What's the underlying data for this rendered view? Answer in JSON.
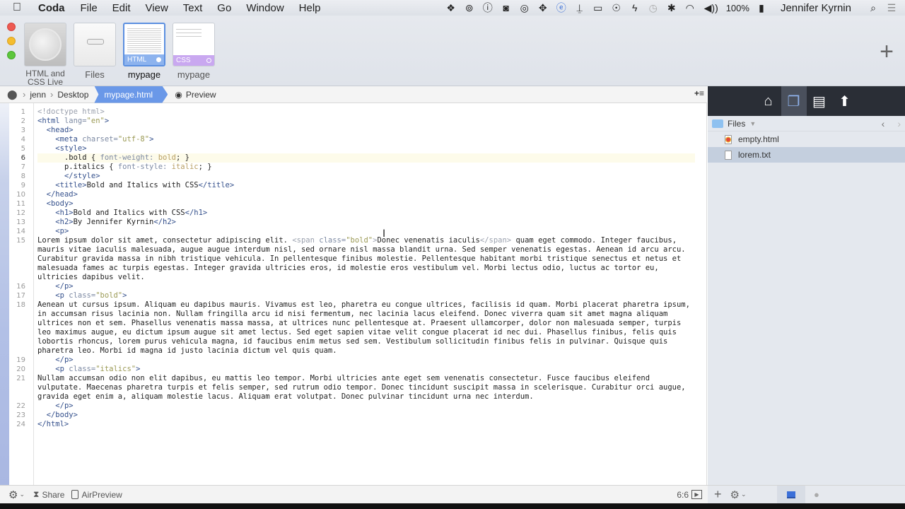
{
  "menubar": {
    "apple": "",
    "app_name": "Coda",
    "menus": [
      "File",
      "Edit",
      "View",
      "Text",
      "Go",
      "Window",
      "Help"
    ],
    "status_icons": [
      "dropbox-icon",
      "openvpn-icon",
      "1password-icon",
      "camera-icon",
      "creative-cloud-icon",
      "paw-icon",
      "te-icon",
      "brush-icon",
      "airplay-icon",
      "accessibility-icon",
      "bolt-icon",
      "time-machine-icon",
      "bluetooth-icon",
      "wifi-icon",
      "volume-icon"
    ],
    "status_glyphs": [
      "❖",
      "⊚",
      "ⓘ",
      "◙",
      "◎",
      "✥",
      "ⓔ",
      "⍊",
      "▭",
      "☉",
      "ϟ",
      "◷",
      "✱",
      "◠",
      "◀))"
    ],
    "battery": "100%",
    "battery_glyph": "▮",
    "user": "Jennifer Kyrnin",
    "search_glyph": "⌕",
    "list_glyph": "☰"
  },
  "toolbar": {
    "sites": [
      {
        "label_line1": "HTML and",
        "label_line2": "CSS Live"
      },
      {
        "label": "Files"
      },
      {
        "label": "mypage",
        "badge": "HTML"
      },
      {
        "label": "mypage",
        "badge": "CSS"
      }
    ],
    "add_glyph": "+"
  },
  "pathbar": {
    "crumbs": [
      "jenn",
      "Desktop"
    ],
    "active_file": "mypage.html",
    "active_chevron": "⌄",
    "preview": "Preview",
    "add_menu": "+≡"
  },
  "editor": {
    "current_line": 6,
    "line_numbers": [
      1,
      2,
      3,
      4,
      5,
      6,
      7,
      8,
      9,
      10,
      11,
      12,
      13,
      14,
      15,
      16,
      17,
      18,
      19,
      20,
      21,
      22,
      23,
      24
    ],
    "lines": {
      "l1": "<!doctype html>",
      "l2_tag_open": "<html ",
      "l2_attr": "lang=",
      "l2_val": "\"en\"",
      "l2_close": ">",
      "l3": "<head>",
      "l4_tag": "<meta ",
      "l4_attr": "charset=",
      "l4_val": "\"utf-8\"",
      "l4_close": ">",
      "l5": "<style>",
      "l6_sel": ".bold { ",
      "l6_prop": "font-weight: ",
      "l6_val": "bold",
      "l6_end": "; }",
      "l7_sel": "p.italics { ",
      "l7_prop": "font-style: ",
      "l7_val": "italic",
      "l7_end": "; }",
      "l8": "</style>",
      "l9_open": "<title>",
      "l9_text": "Bold and Italics with CSS",
      "l9_close": "</title>",
      "l10": "</head>",
      "l11": "<body>",
      "l12_open": "<h1>",
      "l12_text": "Bold and Italics with CSS",
      "l12_close": "</h1>",
      "l13_open": "<h2>",
      "l13_text": "By Jennifer Kyrnin",
      "l13_close": "</h2>",
      "l14": "<p>",
      "l15_a": "Lorem ipsum dolor sit amet, consectetur adipiscing elit. ",
      "l15_span_open": "<span ",
      "l15_span_attr": "class=",
      "l15_span_val": "\"bold\"",
      "l15_span_gt": ">",
      "l15_b": "Donec venenatis iaculis",
      "l15_span_close": "</span>",
      "l15_c": " quam eget commodo. Integer faucibus, mauris vitae iaculis malesuada, augue augue interdum nisl, sed ornare nisl massa blandit urna. Sed semper venenatis egestas. Aenean id arcu arcu. Curabitur gravida massa in nibh tristique vehicula. In pellentesque finibus molestie. Pellentesque habitant morbi tristique senectus et netus et malesuada fames ac turpis egestas. Integer gravida ultricies eros, id molestie eros vestibulum vel. Morbi lectus odio, luctus ac tortor eu, ultricies dapibus velit.",
      "l16": "</p>",
      "l17_tag": "<p ",
      "l17_attr": "class=",
      "l17_val": "\"bold\"",
      "l17_close": ">",
      "l18": "Aenean ut cursus ipsum. Aliquam eu dapibus mauris. Vivamus est leo, pharetra eu congue ultrices, facilisis id quam. Morbi placerat pharetra ipsum, in accumsan risus lacinia non. Nullam fringilla arcu id nisi fermentum, nec lacinia lacus eleifend. Donec viverra quam sit amet magna aliquam ultrices non et sem. Phasellus venenatis massa massa, at ultrices nunc pellentesque at. Praesent ullamcorper, dolor non malesuada semper, turpis leo maximus augue, eu dictum ipsum augue sit amet lectus. Sed eget sapien vitae velit congue placerat id nec dui. Phasellus finibus, felis quis lobortis rhoncus, lorem purus vehicula magna, id faucibus enim metus sed sem. Vestibulum sollicitudin finibus felis in pulvinar. Quisque quis pharetra leo. Morbi id magna id justo lacinia dictum vel quis quam.",
      "l19": "</p>",
      "l20_tag": "<p ",
      "l20_attr": "class=",
      "l20_val": "\"italics\"",
      "l20_close": ">",
      "l21": "Nullam accumsan odio non elit dapibus, eu mattis leo tempor. Morbi ultricies ante eget sem venenatis consectetur. Fusce faucibus eleifend vulputate. Maecenas pharetra turpis et felis semper, sed rutrum odio tempor. Donec tincidunt suscipit massa in scelerisque. Curabitur orci augue, gravida eget enim a, aliquam molestie lacus. Aliquam erat volutpat. Donec pulvinar tincidunt urna nec interdum.",
      "l22": "</p>",
      "l23": "</body>",
      "l24": "</html>"
    }
  },
  "sidebar": {
    "tabs": [
      "home-icon",
      "files-icon",
      "snippets-icon",
      "publish-icon"
    ],
    "tab_glyphs": [
      "⌂",
      "❐",
      "▤",
      "⬆"
    ],
    "folder": "Files",
    "nav_back": "‹",
    "nav_forward": "›",
    "files": [
      {
        "name": "empty.html",
        "type": "html",
        "selected": false
      },
      {
        "name": "lorem.txt",
        "type": "txt",
        "selected": true
      }
    ]
  },
  "statusbar": {
    "gear_glyph": "⚙",
    "share": "Share",
    "airpreview": "AirPreview",
    "cursor_position": "6:6",
    "play_glyph": "▶"
  },
  "sidebar_bottom": {
    "add_glyph": "+",
    "gear_glyph": "⚙",
    "remote_glyph": "●"
  },
  "colors": {
    "accent": "#6a98e8",
    "sidebar_dark": "#2a2e36",
    "selected_row": "#c4cfde"
  }
}
